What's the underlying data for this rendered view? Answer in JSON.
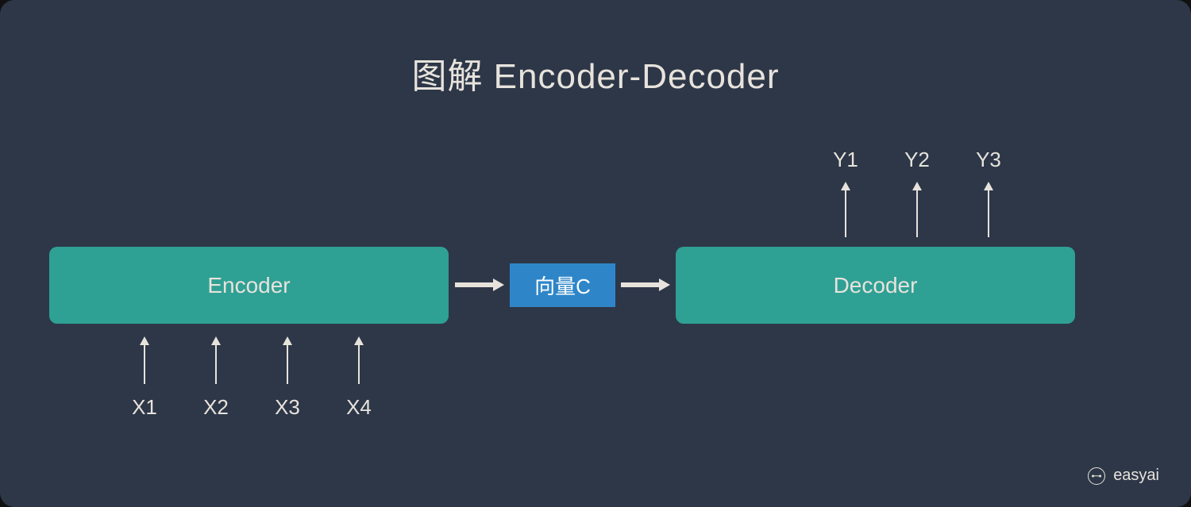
{
  "title": "图解 Encoder-Decoder",
  "encoder": {
    "label": "Encoder"
  },
  "vector": {
    "label": "向量C"
  },
  "decoder": {
    "label": "Decoder"
  },
  "inputs": [
    "X1",
    "X2",
    "X3",
    "X4"
  ],
  "outputs": [
    "Y1",
    "Y2",
    "Y3"
  ],
  "watermark": "easyai",
  "chart_data": {
    "type": "diagram",
    "title": "图解 Encoder-Decoder",
    "nodes": [
      {
        "id": "encoder",
        "label": "Encoder",
        "kind": "block"
      },
      {
        "id": "vectorC",
        "label": "向量C",
        "kind": "block"
      },
      {
        "id": "decoder",
        "label": "Decoder",
        "kind": "block"
      }
    ],
    "edges": [
      {
        "from": "X1",
        "to": "encoder"
      },
      {
        "from": "X2",
        "to": "encoder"
      },
      {
        "from": "X3",
        "to": "encoder"
      },
      {
        "from": "X4",
        "to": "encoder"
      },
      {
        "from": "encoder",
        "to": "vectorC"
      },
      {
        "from": "vectorC",
        "to": "decoder"
      },
      {
        "from": "decoder",
        "to": "Y1"
      },
      {
        "from": "decoder",
        "to": "Y2"
      },
      {
        "from": "decoder",
        "to": "Y3"
      }
    ],
    "inputs": [
      "X1",
      "X2",
      "X3",
      "X4"
    ],
    "outputs": [
      "Y1",
      "Y2",
      "Y3"
    ]
  }
}
